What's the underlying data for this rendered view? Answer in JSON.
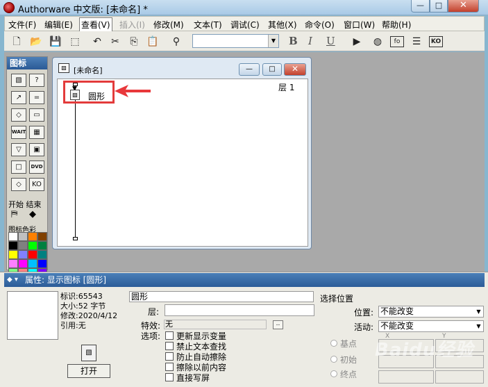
{
  "window": {
    "title": "Authorware 中文版: [未命名] *",
    "min_label": "—",
    "max_label": "□",
    "close_label": "✕"
  },
  "menu": [
    "文件(F)",
    "编辑(E)",
    "查看(V)",
    "插入(I)",
    "修改(M)",
    "文本(T)",
    "调试(C)",
    "其他(X)",
    "命令(O)",
    "窗口(W)",
    "帮助(H)"
  ],
  "menu_state": {
    "active": "查看(V)",
    "disabled": "插入(I)"
  },
  "toolbar": {
    "icons": [
      "new-icon",
      "open-icon",
      "save-all-icon",
      "import-icon",
      "undo-icon",
      "cut-icon",
      "copy-icon",
      "paste-icon",
      "find-icon"
    ],
    "font_value": "",
    "bold": "B",
    "italic": "I",
    "underline": "U",
    "right_icons": [
      "run-icon",
      "control-panel-icon",
      "functions-icon",
      "variables-icon",
      "knowledge-objects-icon"
    ],
    "fo_label": "fo",
    "ko_label": "KO"
  },
  "palette": {
    "title": "图标",
    "icons": [
      {
        "name": "display-icon",
        "glyph": "▧"
      },
      {
        "name": "interaction-icon",
        "glyph": "?"
      },
      {
        "name": "motion-icon",
        "glyph": "↗"
      },
      {
        "name": "calculation-icon",
        "glyph": "="
      },
      {
        "name": "erase-icon",
        "glyph": "◇"
      },
      {
        "name": "navigate-icon",
        "glyph": "▭"
      },
      {
        "name": "wait-icon",
        "glyph": "WAIT"
      },
      {
        "name": "framework-icon",
        "glyph": "▦"
      },
      {
        "name": "decision-icon",
        "glyph": "▽"
      },
      {
        "name": "digital-movie-icon",
        "glyph": "▣"
      },
      {
        "name": "map-icon",
        "glyph": "□"
      },
      {
        "name": "dvd-icon",
        "glyph": "DVD"
      },
      {
        "name": "sound-icon",
        "glyph": "◇"
      },
      {
        "name": "knowledge-object-icon",
        "glyph": "KO"
      }
    ],
    "start_end_label": "开始 结束",
    "color_label": "图标色彩",
    "colors": [
      "#ffffff",
      "#c0c0c0",
      "#ff8000",
      "#804000",
      "#000000",
      "#808080",
      "#00ff00",
      "#008040",
      "#ffff00",
      "#8080ff",
      "#ff0000",
      "#008080",
      "#ff80ff",
      "#ff00ff",
      "#00c0ff",
      "#0000ff",
      "#80ff80",
      "#ff8080",
      "#00ffff",
      "#8000ff"
    ]
  },
  "flow_window": {
    "title": "[未命名]",
    "level_label": "层 1",
    "icon_label": "圆形"
  },
  "properties": {
    "header": "属性: 显示图标 [圆形]",
    "meta": {
      "id": "标识:65543",
      "size": "大小:52 字节",
      "modified": "修改:2020/4/12",
      "ref": "引用:无"
    },
    "open_button": "打开",
    "name_value": "圆形",
    "layer_label": "层:",
    "layer_value": "",
    "effect_label": "特效:",
    "effect_value": "无",
    "effect_button": "..",
    "options_label": "选项:",
    "options": [
      "更新显示变量",
      "禁止文本查找",
      "防止自动擦除",
      "擦除以前内容",
      "直接写屏"
    ],
    "position_section": "选择位置",
    "position_label": "位置:",
    "position_value": "不能改变",
    "activity_label": "活动:",
    "activity_value": "不能改变",
    "radios": [
      "基点",
      "初始",
      "终点"
    ],
    "x_label": "X",
    "y_label": "Y"
  },
  "watermark": "Baidu经验"
}
